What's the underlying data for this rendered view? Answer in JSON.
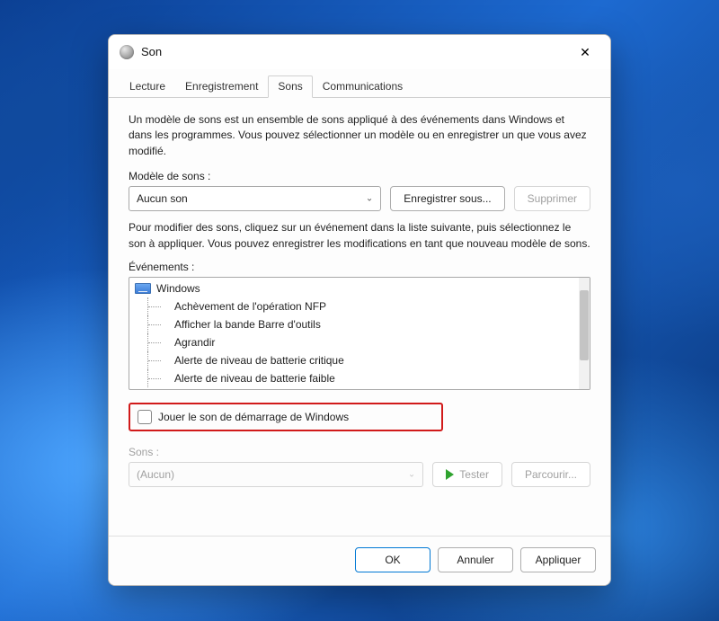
{
  "window": {
    "title": "Son"
  },
  "tabs": [
    {
      "label": "Lecture",
      "active": false
    },
    {
      "label": "Enregistrement",
      "active": false
    },
    {
      "label": "Sons",
      "active": true
    },
    {
      "label": "Communications",
      "active": false
    }
  ],
  "scheme": {
    "description": "Un modèle de sons est un ensemble de sons appliqué à des événements dans Windows et dans les programmes. Vous pouvez sélectionner un modèle ou en enregistrer un que vous avez modifié.",
    "label": "Modèle de sons :",
    "value": "Aucun son",
    "save_as": "Enregistrer sous...",
    "delete": "Supprimer"
  },
  "events": {
    "description": "Pour modifier des sons, cliquez sur un événement dans la liste suivante, puis sélectionnez le son à appliquer. Vous pouvez enregistrer les modifications en tant que nouveau modèle de sons.",
    "label": "Événements :",
    "root": "Windows",
    "items": [
      "Achèvement de l'opération NFP",
      "Afficher la bande Barre d'outils",
      "Agrandir",
      "Alerte de niveau de batterie critique",
      "Alerte de niveau de batterie faible"
    ]
  },
  "startup_sound": {
    "checked": false,
    "label": "Jouer le son de démarrage de Windows"
  },
  "sounds": {
    "label": "Sons :",
    "value": "(Aucun)",
    "test": "Tester",
    "browse": "Parcourir..."
  },
  "footer": {
    "ok": "OK",
    "cancel": "Annuler",
    "apply": "Appliquer"
  }
}
